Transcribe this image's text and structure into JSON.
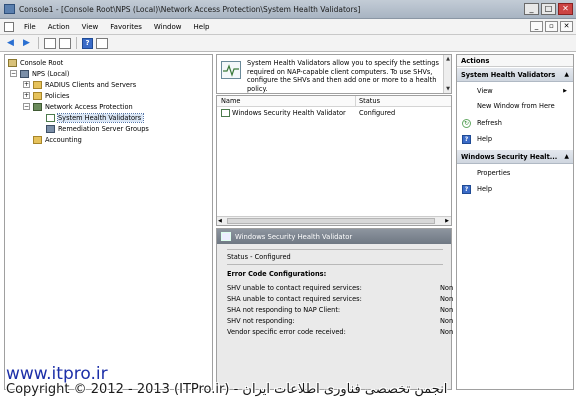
{
  "window": {
    "title": "Console1 - [Console Root\\NPS (Local)\\Network Access Protection\\System Health Validators]",
    "min_glyph": "_",
    "max_glyph": "□",
    "close_glyph": "✕"
  },
  "menu": {
    "items": [
      "File",
      "Action",
      "View",
      "Favorites",
      "Window",
      "Help"
    ],
    "child_min": "_",
    "child_restore": "▫",
    "child_close": "✕"
  },
  "toolbar": {
    "icons": [
      "back-arrow-icon",
      "forward-arrow-icon",
      "up-folder-icon",
      "show-hide-tree-icon",
      "help-icon",
      "properties-icon"
    ]
  },
  "tree": {
    "items": [
      {
        "label": "Console Root",
        "indent": 0,
        "expander": ""
      },
      {
        "label": "NPS (Local)",
        "indent": 1,
        "expander": "−"
      },
      {
        "label": "RADIUS Clients and Servers",
        "indent": 2,
        "expander": "+"
      },
      {
        "label": "Policies",
        "indent": 2,
        "expander": "+"
      },
      {
        "label": "Network Access Protection",
        "indent": 2,
        "expander": "−"
      },
      {
        "label": "System Health Validators",
        "indent": 3,
        "expander": ""
      },
      {
        "label": "Remediation Server Groups",
        "indent": 3,
        "expander": ""
      },
      {
        "label": "Accounting",
        "indent": 2,
        "expander": ""
      }
    ]
  },
  "description": {
    "text": "System Health Validators allow you to specify the settings required on NAP-capable client computers. To use SHVs, configure the SHVs and then add one or more to a health policy."
  },
  "list": {
    "col_name": "Name",
    "col_status": "Status",
    "rows": [
      {
        "name": "Windows Security Health Validator",
        "status": "Configured"
      }
    ]
  },
  "detail": {
    "header": "Windows Security Health Validator",
    "status": "Status - Configured",
    "section_title": "Error Code Configurations:",
    "rows": [
      {
        "label": "SHV unable to contact required services:",
        "value": "Non"
      },
      {
        "label": "SHA unable to contact required services:",
        "value": "Non"
      },
      {
        "label": "SHA not responding to NAP Client:",
        "value": "Non"
      },
      {
        "label": "SHV not responding:",
        "value": "Non"
      },
      {
        "label": "Vendor specific error code received:",
        "value": "Non"
      }
    ]
  },
  "actions": {
    "title": "Actions",
    "group1": "System Health Validators",
    "group1_items": {
      "view": "View",
      "new_window": "New Window from Here",
      "refresh": "Refresh",
      "help": "Help"
    },
    "group2": "Windows Security Healt...",
    "group2_items": {
      "properties": "Properties",
      "help": "Help"
    }
  },
  "watermark": {
    "site": "www.itpro.ir",
    "copyright": "Copyright © 2012 - 2013 (ITPro.ir) - انجمن تخصصی فناوری اطلاعات ایران"
  }
}
